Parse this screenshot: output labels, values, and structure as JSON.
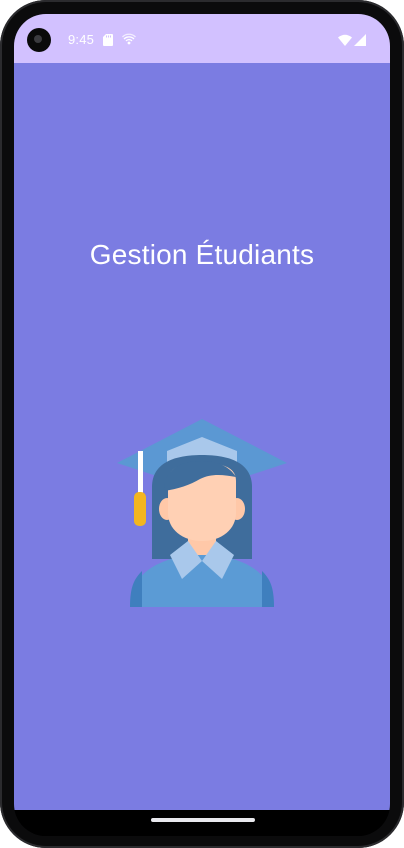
{
  "status_bar": {
    "time": "9:45",
    "icons": [
      "sd-card-icon",
      "cast-icon",
      "wifi-icon",
      "signal-icon"
    ]
  },
  "app": {
    "title": "Gestion Étudiants",
    "illustration": "graduate-student-icon"
  },
  "colors": {
    "status_bar": "#d2c1ff",
    "background": "#7b7ce2",
    "text": "#ffffff"
  }
}
